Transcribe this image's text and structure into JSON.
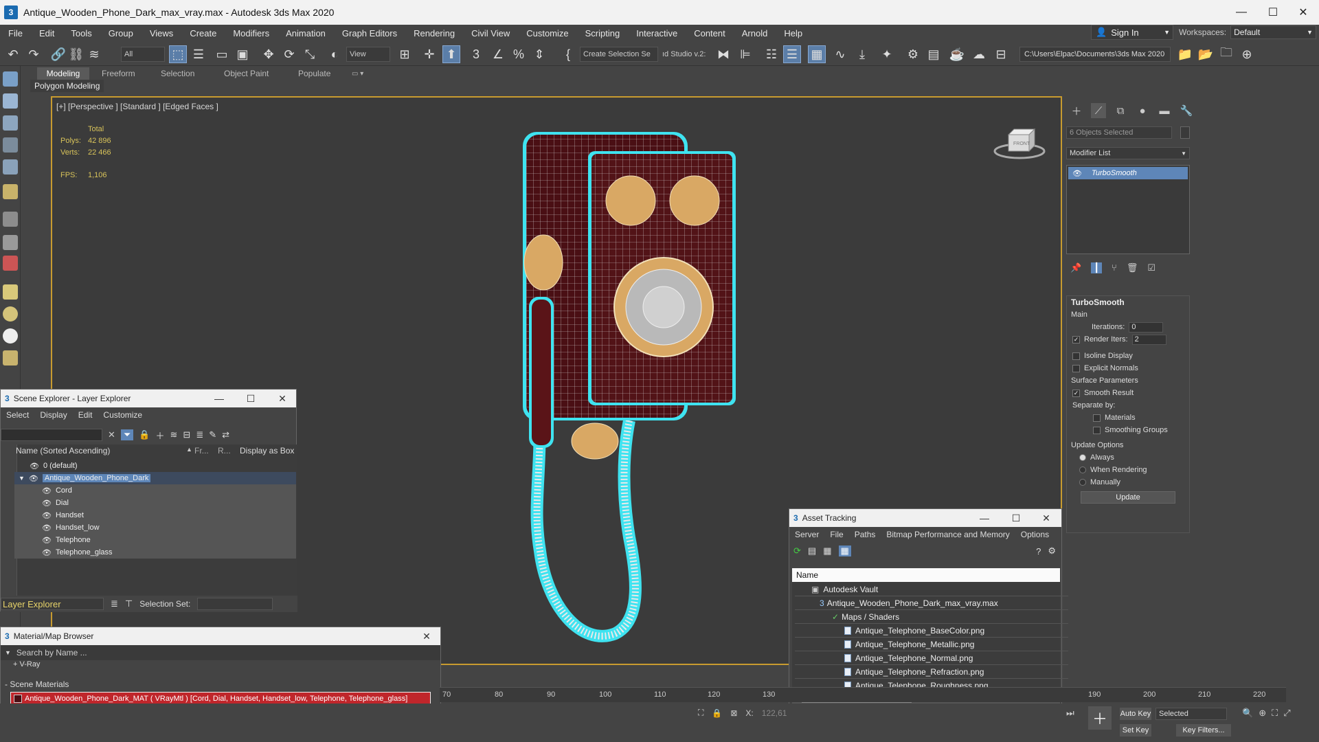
{
  "window": {
    "app_icon": "3",
    "title": "Antique_Wooden_Phone_Dark_max_vray.max - Autodesk 3ds Max 2020",
    "controls": {
      "minimize": "—",
      "maximize": "☐",
      "close": "✕"
    }
  },
  "menu": [
    "File",
    "Edit",
    "Tools",
    "Group",
    "Views",
    "Create",
    "Modifiers",
    "Animation",
    "Graph Editors",
    "Rendering",
    "Civil View",
    "Customize",
    "Scripting",
    "Interactive",
    "Content",
    "Arnold",
    "Help"
  ],
  "account": {
    "signin_label": "Sign In",
    "workspaces_label": "Workspaces:",
    "workspace_value": "Default"
  },
  "toolbar": {
    "filter_value": "All",
    "view_value": "View",
    "selection_set": "Create Selection Se",
    "studio_label": "ıd Studio v.2:",
    "project_path": "C:\\Users\\Elpac\\Documents\\3ds Max 2020"
  },
  "ribbon": {
    "tabs": [
      "Modeling",
      "Freeform",
      "Selection",
      "Object Paint",
      "Populate"
    ],
    "subpanel": "Polygon Modeling"
  },
  "viewport": {
    "label": "[+] [Perspective ] [Standard ] [Edged Faces ]",
    "stats_total": "Total",
    "polys_label": "Polys:",
    "polys_value": "42 896",
    "verts_label": "Verts:",
    "verts_value": "22 466",
    "fps_label": "FPS:",
    "fps_value": "1,106",
    "viewcube_label": "FRONT"
  },
  "command_panel": {
    "objects_selected": "6 Objects Selected",
    "modifier_list": "Modifier List",
    "stack_item": "TurboSmooth",
    "turbosmooth": {
      "title": "TurboSmooth",
      "main": "Main",
      "iterations_label": "Iterations:",
      "iterations_value": "0",
      "render_iters_label": "Render Iters:",
      "render_iters_value": "2",
      "isoline": "Isoline Display",
      "explicit_normals": "Explicit Normals",
      "surface_params": "Surface Parameters",
      "smooth_result": "Smooth Result",
      "separate_by": "Separate by:",
      "materials": "Materials",
      "smoothing_groups": "Smoothing Groups",
      "update_options": "Update Options",
      "always": "Always",
      "when_rendering": "When Rendering",
      "manually": "Manually",
      "update_button": "Update"
    }
  },
  "scene_explorer": {
    "title": "Scene Explorer - Layer Explorer",
    "menu": [
      "Select",
      "Display",
      "Edit",
      "Customize"
    ],
    "columns": [
      "Name (Sorted Ascending)",
      "Fr...",
      "R...",
      "Display as Box"
    ],
    "rows": [
      {
        "name": "0 (default)",
        "level": 1
      },
      {
        "name": "Antique_Wooden_Phone_Dark",
        "level": 1
      },
      {
        "name": "Cord",
        "level": 2
      },
      {
        "name": "Dial",
        "level": 2
      },
      {
        "name": "Handset",
        "level": 2
      },
      {
        "name": "Handset_low",
        "level": 2
      },
      {
        "name": "Telephone",
        "level": 2
      },
      {
        "name": "Telephone_glass",
        "level": 2
      }
    ],
    "footer_explorer": "Layer Explorer",
    "footer_selection_set": "Selection Set:"
  },
  "material_browser": {
    "title": "Material/Map Browser",
    "search_placeholder": "Search by Name ...",
    "vray_group": "+ V-Ray",
    "scene_materials": "- Scene Materials",
    "material_entry": "Antique_Wooden_Phone_Dark_MAT ( VRayMtl ) [Cord, Dial, Handset, Handset_low, Telephone, Telephone_glass]"
  },
  "asset_tracking": {
    "title": "Asset Tracking",
    "menu": [
      "Server",
      "File",
      "Paths",
      "Bitmap Performance and Memory",
      "Options"
    ],
    "column": "Name",
    "rows": [
      {
        "name": "Autodesk Vault",
        "level": 0
      },
      {
        "name": "Antique_Wooden_Phone_Dark_max_vray.max",
        "level": 1
      },
      {
        "name": "Maps / Shaders",
        "level": 2
      },
      {
        "name": "Antique_Telephone_BaseColor.png",
        "level": 3
      },
      {
        "name": "Antique_Telephone_Metallic.png",
        "level": 3
      },
      {
        "name": "Antique_Telephone_Normal.png",
        "level": 3
      },
      {
        "name": "Antique_Telephone_Refraction.png",
        "level": 3
      },
      {
        "name": "Antique_Telephone_Roughness.png",
        "level": 3
      }
    ]
  },
  "timeline": {
    "ticks": [
      "70",
      "80",
      "90",
      "100",
      "110",
      "120",
      "130",
      "190",
      "200",
      "210",
      "220"
    ]
  },
  "status": {
    "x_label": "X:",
    "x_value": "122,61",
    "auto_key": "Auto Key",
    "set_key": "Set Key",
    "selected": "Selected",
    "key_filters": "Key Filters..."
  },
  "colors": {
    "viewport_border": "#c89b2f",
    "selection_blue": "#5e86b8",
    "wireframe_cyan": "#3fe3f0",
    "material_highlight": "#c0262b"
  }
}
